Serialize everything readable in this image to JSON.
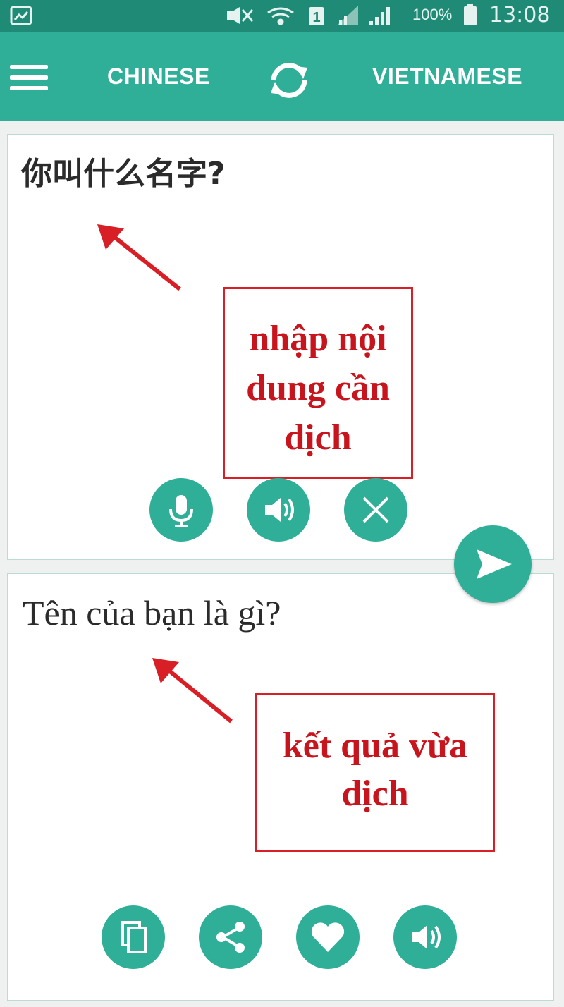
{
  "status_bar": {
    "battery_percent": "100%",
    "time": "13:08"
  },
  "toolbar": {
    "source_language": "CHINESE",
    "target_language": "VIETNAMESE"
  },
  "input": {
    "text": "你叫什么名字?"
  },
  "output": {
    "text": "Tên của bạn là gì?"
  },
  "annotations": {
    "input_note": [
      "nhập nội",
      "dung cần",
      "dịch"
    ],
    "output_note": [
      "kết quả vừa",
      "dịch"
    ]
  },
  "icons": {
    "menu": "hamburger-icon",
    "swap": "swap-icon",
    "mic": "mic-icon",
    "speaker": "speaker-icon",
    "clear": "close-icon",
    "send": "send-icon",
    "copy": "copy-icon",
    "share": "share-icon",
    "favorite": "heart-icon"
  },
  "colors": {
    "status_bar": "#1f8b77",
    "toolbar": "#2fae98",
    "accent": "#2fae98",
    "annotation": "#d81f26"
  }
}
